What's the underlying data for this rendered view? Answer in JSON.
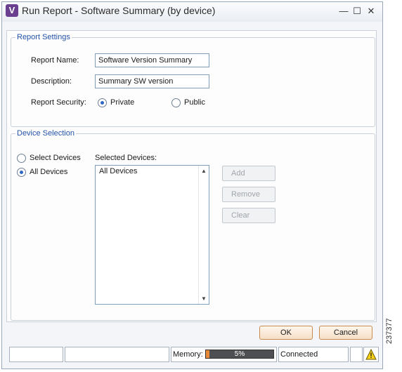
{
  "window": {
    "title": "Run Report - Software Summary (by device)",
    "app_icon_letter": "V",
    "minimize": "—",
    "maximize": "☐",
    "close": "✕"
  },
  "report_settings": {
    "legend": "Report Settings",
    "name_label": "Report Name:",
    "name_value": "Software Version Summary",
    "description_label": "Description:",
    "description_value": "Summary SW version",
    "security_label": "Report Security:",
    "security_options": [
      {
        "label": "Private",
        "checked": true
      },
      {
        "label": "Public",
        "checked": false
      }
    ]
  },
  "device_selection": {
    "legend": "Device Selection",
    "mode_options": [
      {
        "label": "Select Devices",
        "checked": false
      },
      {
        "label": "All Devices",
        "checked": true
      }
    ],
    "selected_label": "Selected Devices:",
    "selected_items": [
      "All Devices"
    ],
    "scroll_up": "▲",
    "scroll_down": "▼",
    "buttons": {
      "add": "Add",
      "remove": "Remove",
      "clear": "Clear"
    }
  },
  "dialog_buttons": {
    "ok": "OK",
    "cancel": "Cancel"
  },
  "status_bar": {
    "memory_label": "Memory:",
    "memory_percent": "5%",
    "memory_fraction": 0.05,
    "connection": "Connected"
  },
  "figure_id": "237377",
  "colors": {
    "accent_legend": "#2452a6",
    "memory_bar": "#4e4f52",
    "memory_fill": "#e8893a",
    "app_icon": "#6b3f8f"
  }
}
